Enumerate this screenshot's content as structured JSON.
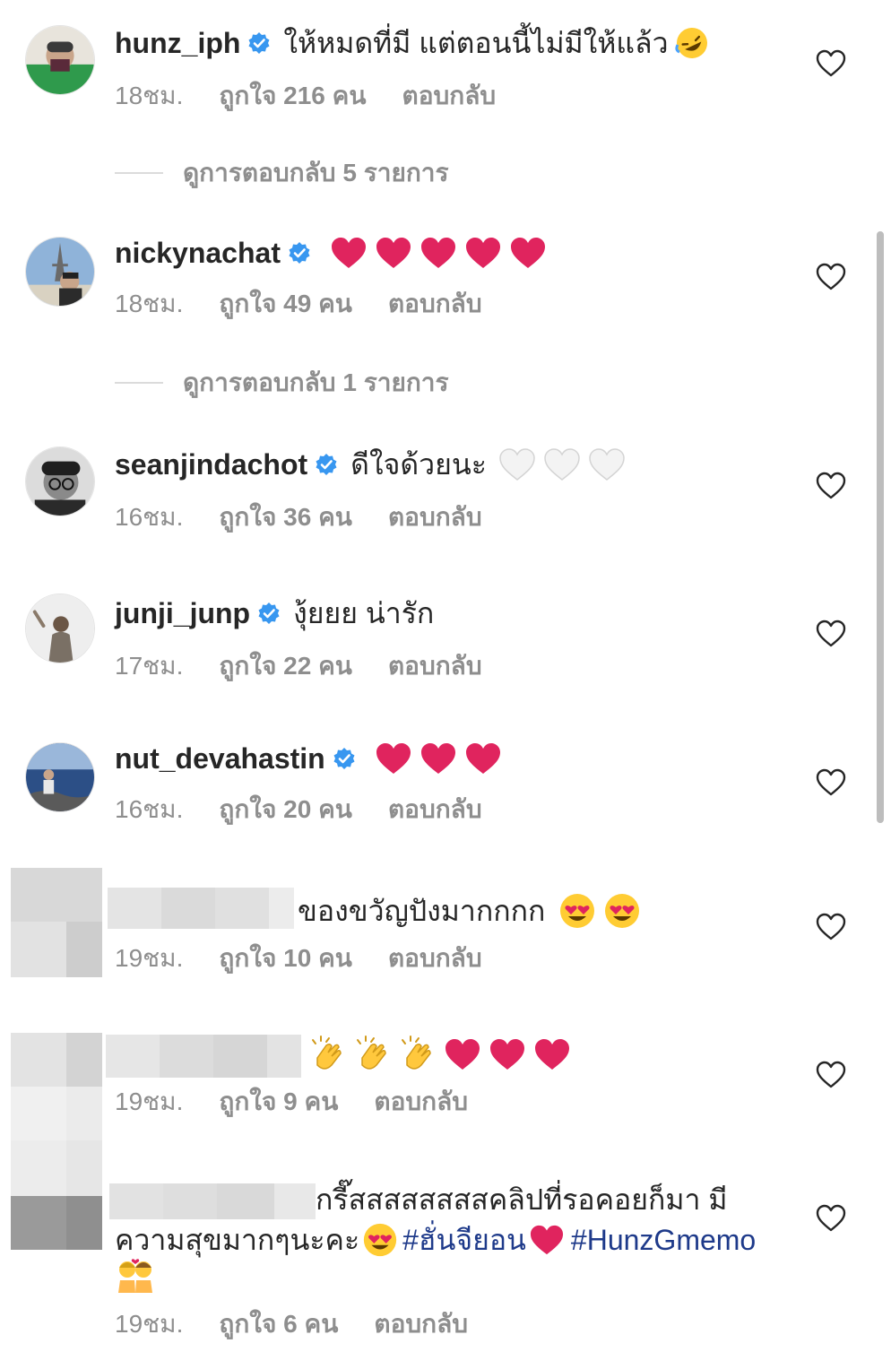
{
  "comments": [
    {
      "username": "hunz_iph",
      "text": "ให้หมดที่มี แต่ตอนนี้ไม่มีให้แล้ว",
      "emoji": "🤣",
      "time": "18ชม.",
      "likes": "ถูกใจ 216 คน",
      "reply": "ตอบกลับ",
      "view_replies": "ดูการตอบกลับ 5 รายการ"
    },
    {
      "username": "nickynachat",
      "text": "",
      "emoji": "❤️❤️❤️❤️❤️",
      "time": "18ชม.",
      "likes": "ถูกใจ 49 คน",
      "reply": "ตอบกลับ",
      "view_replies": "ดูการตอบกลับ 1 รายการ"
    },
    {
      "username": "seanjindachot",
      "text": "ดีใจด้วยนะ",
      "emoji": "🤍🤍🤍",
      "time": "16ชม.",
      "likes": "ถูกใจ 36 คน",
      "reply": "ตอบกลับ"
    },
    {
      "username": "junji_junp",
      "text": "งุ้ยยย น่ารัก",
      "time": "17ชม.",
      "likes": "ถูกใจ 22 คน",
      "reply": "ตอบกลับ"
    },
    {
      "username": "nut_devahastin",
      "text": "",
      "emoji": "❤️❤️❤️",
      "time": "16ชม.",
      "likes": "ถูกใจ 20 คน",
      "reply": "ตอบกลับ"
    },
    {
      "username": "",
      "text": "ของขวัญปังมากกกก",
      "emoji": "😍😍",
      "time": "19ชม.",
      "likes": "ถูกใจ 10 คน",
      "reply": "ตอบกลับ"
    },
    {
      "username": "",
      "text": "",
      "emoji": "👏👏👏❤️❤️❤️",
      "time": "19ชม.",
      "likes": "ถูกใจ 9 คน",
      "reply": "ตอบกลับ"
    },
    {
      "username": "",
      "text_line1": "กรี๊สสสสสสสสคลิปที่รอคอยก็มา มี",
      "text_line2": "ความสุขมากๆนะคะ",
      "hashtag1": "#ฮั่นจียอน",
      "hashtag2": "#HunzGmemo",
      "emoji": "😍❤️💏",
      "time": "19ชม.",
      "likes": "ถูกใจ 6 คน",
      "reply": "ตอบกลับ"
    }
  ],
  "icons": {
    "verified": "verified-badge-icon",
    "like": "heart-outline-icon"
  },
  "colors": {
    "verified": "#3897f0",
    "muted": "#8e8e8e",
    "text": "#262626",
    "heart": "#e0245e",
    "hashtag": "#1e3a8a"
  }
}
